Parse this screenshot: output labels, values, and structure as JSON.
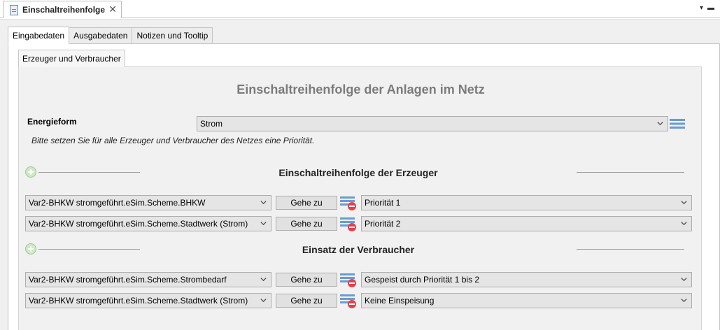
{
  "editor_tab": {
    "title": "Einschaltreihenfolge",
    "close": "✕"
  },
  "view_menu": {
    "arrow": "▾",
    "minimize": "▬"
  },
  "page_tabs": [
    {
      "label": "Eingabedaten",
      "active": true
    },
    {
      "label": "Ausgabedaten",
      "active": false
    },
    {
      "label": "Notizen und Tooltip",
      "active": false
    }
  ],
  "section_tab": {
    "label": "Erzeuger und Verbraucher"
  },
  "form": {
    "title": "Einschaltreihenfolge der Anlagen im Netz",
    "energy_label": "Energieform",
    "energy_value": "Strom",
    "hint": "Bitte setzen Sie für alle Erzeuger und Verbraucher des Netzes eine Priorität."
  },
  "producers": {
    "title": "Einschaltreihenfolge der Erzeuger",
    "rows": [
      {
        "component": "Var2-BHKW stromgeführt.eSim.Scheme.BHKW",
        "goto": "Gehe zu",
        "priority": "Priorität 1"
      },
      {
        "component": "Var2-BHKW stromgeführt.eSim.Scheme.Stadtwerk (Strom)",
        "goto": "Gehe zu",
        "priority": "Priorität 2"
      }
    ]
  },
  "consumers": {
    "title": "Einsatz der Verbraucher",
    "rows": [
      {
        "component": "Var2-BHKW stromgeführt.eSim.Scheme.Strombedarf",
        "goto": "Gehe zu",
        "priority": "Gespeist durch Priorität 1 bis 2"
      },
      {
        "component": "Var2-BHKW stromgeführt.eSim.Scheme.Stadtwerk (Strom)",
        "goto": "Gehe zu",
        "priority": "Keine Einspeisung"
      }
    ]
  },
  "colors": {
    "title_gray": "#7b7b7b",
    "add_green": "#cfe9c6",
    "remove_red": "#e0424c",
    "list_blue": "#6b9bd2"
  }
}
